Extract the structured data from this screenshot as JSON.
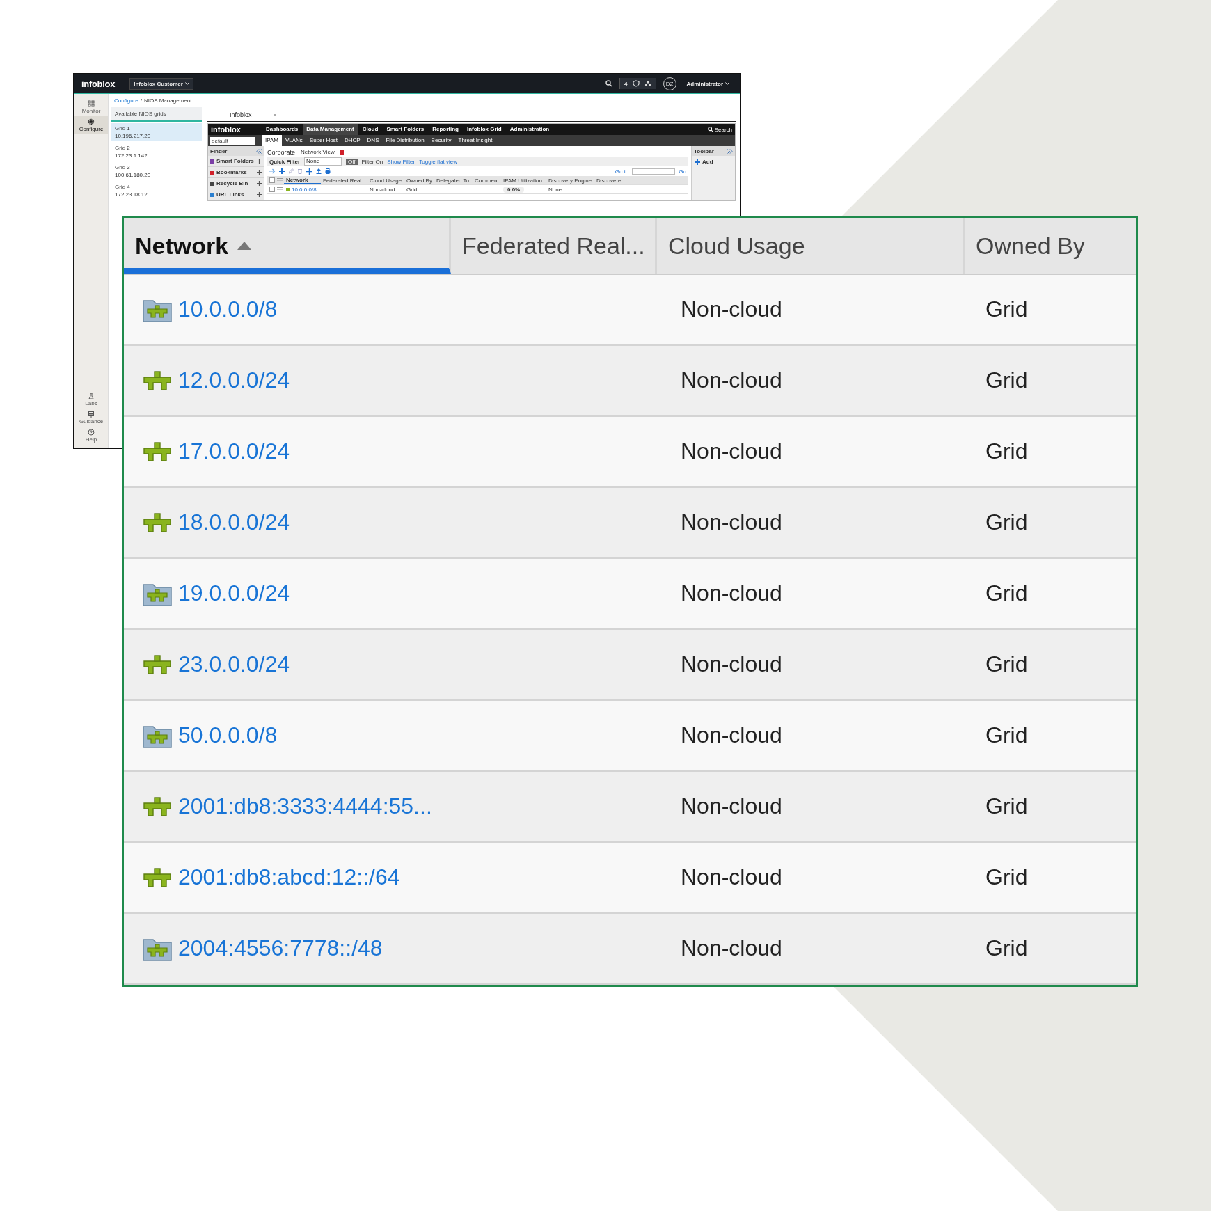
{
  "topbar": {
    "logo": "infoblox",
    "account": "Infoblox Customer",
    "count": "4",
    "user_initials": "DZ",
    "user": "Administrator"
  },
  "nav": [
    {
      "label": "Monitor",
      "kind": "grid",
      "selected": false
    },
    {
      "label": "Configure",
      "kind": "gear",
      "selected": true
    }
  ],
  "nav_bottom": [
    {
      "label": "Labs",
      "kind": "flask"
    },
    {
      "label": "Guidance",
      "kind": "sign"
    },
    {
      "label": "Help",
      "kind": "help"
    }
  ],
  "breadcrumb": [
    "Configure",
    "NIOS Management"
  ],
  "breadcrumb_separator": "/",
  "grids_panel": {
    "title": "Available NIOS grids",
    "grids": [
      {
        "name": "Grid 1",
        "address": "10.196.217.20",
        "selected": true
      },
      {
        "name": "Grid 2",
        "address": "172.23.1.142",
        "selected": false
      },
      {
        "name": "Grid 3",
        "address": "100.61.180.20",
        "selected": false
      },
      {
        "name": "Grid 4",
        "address": "172.23.18.12",
        "selected": false
      }
    ]
  },
  "tab": {
    "label": "Infoblox"
  },
  "nios": {
    "logo": "infoblox",
    "menu": [
      {
        "label": "Dashboards",
        "selected": false
      },
      {
        "label": "Data Management",
        "selected": true
      },
      {
        "label": "Cloud",
        "selected": false
      },
      {
        "label": "Smart Folders",
        "selected": false
      },
      {
        "label": "Reporting",
        "selected": false
      },
      {
        "label": "Infoblox Grid",
        "selected": false
      },
      {
        "label": "Administration",
        "selected": false
      }
    ],
    "search": "Search",
    "view_select": "default",
    "subtabs": [
      {
        "label": "IPAM",
        "selected": true
      },
      {
        "label": "VLANs",
        "selected": false
      },
      {
        "label": "Super Host",
        "selected": false
      },
      {
        "label": "DHCP",
        "selected": false
      },
      {
        "label": "DNS",
        "selected": false
      },
      {
        "label": "File Distribution",
        "selected": false
      },
      {
        "label": "Security",
        "selected": false
      },
      {
        "label": "Threat Insight",
        "selected": false
      }
    ],
    "finder": {
      "title": "Finder",
      "items": [
        {
          "label": "Smart Folders",
          "color": "#7b3fa6"
        },
        {
          "label": "Bookmarks",
          "color": "#d0202a"
        },
        {
          "label": "Recycle Bin",
          "color": "#444444"
        },
        {
          "label": "URL Links",
          "color": "#2a7fd0"
        }
      ]
    },
    "title": "Corporate",
    "network_view": "Network View",
    "quick_filter_label": "Quick Filter",
    "quick_filter": "None",
    "filter_toggle": "Off",
    "filter_on": "Filter On",
    "show_filter": "Show Filter",
    "toggle_flat": "Toggle flat view",
    "goto_label": "Go to",
    "go": "Go",
    "header_checked": false,
    "columns": [
      {
        "label": "Network",
        "sorted": true
      },
      {
        "label": "Federated Real...",
        "sorted": false
      },
      {
        "label": "Cloud Usage",
        "sorted": false
      },
      {
        "label": "Owned By",
        "sorted": false
      },
      {
        "label": "Delegated To",
        "sorted": false
      },
      {
        "label": "Comment",
        "sorted": false
      },
      {
        "label": "IPAM Utilization",
        "sorted": false
      },
      {
        "label": "Discovery Engine",
        "sorted": false
      },
      {
        "label": "Discovere",
        "sorted": false
      }
    ],
    "rows": [
      {
        "checked": false,
        "network": "10.0.0.0/8",
        "cloud_usage": "Non-cloud",
        "owned_by": "Grid",
        "ipam": "0.0%",
        "discovery_engine": "None"
      }
    ],
    "toolbar": {
      "title": "Toolbar",
      "add": "Add"
    }
  },
  "zoom_table": {
    "columns": [
      {
        "label": "Network",
        "sorted": true
      },
      {
        "label": "Federated Real...",
        "sorted": false
      },
      {
        "label": "Cloud Usage",
        "sorted": false
      },
      {
        "label": "Owned By",
        "sorted": false
      }
    ],
    "rows": [
      {
        "kind": "container",
        "network": "10.0.0.0/8",
        "cloud_usage": "Non-cloud",
        "owned_by": "Grid"
      },
      {
        "kind": "network",
        "network": "12.0.0.0/24",
        "cloud_usage": "Non-cloud",
        "owned_by": "Grid"
      },
      {
        "kind": "network",
        "network": "17.0.0.0/24",
        "cloud_usage": "Non-cloud",
        "owned_by": "Grid"
      },
      {
        "kind": "network",
        "network": "18.0.0.0/24",
        "cloud_usage": "Non-cloud",
        "owned_by": "Grid"
      },
      {
        "kind": "container",
        "network": "19.0.0.0/24",
        "cloud_usage": "Non-cloud",
        "owned_by": "Grid"
      },
      {
        "kind": "network",
        "network": "23.0.0.0/24",
        "cloud_usage": "Non-cloud",
        "owned_by": "Grid"
      },
      {
        "kind": "container",
        "network": "50.0.0.0/8",
        "cloud_usage": "Non-cloud",
        "owned_by": "Grid"
      },
      {
        "kind": "network",
        "network": "2001:db8:3333:4444:55...",
        "cloud_usage": "Non-cloud",
        "owned_by": "Grid"
      },
      {
        "kind": "network",
        "network": "2001:db8:abcd:12::/64",
        "cloud_usage": "Non-cloud",
        "owned_by": "Grid"
      },
      {
        "kind": "container",
        "network": "2004:4556:7778::/48",
        "cloud_usage": "Non-cloud",
        "owned_by": "Grid"
      }
    ]
  }
}
